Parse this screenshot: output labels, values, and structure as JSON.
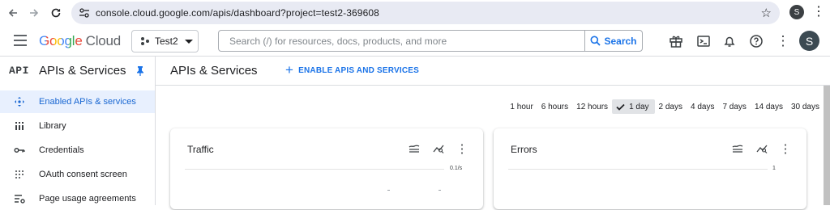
{
  "browser": {
    "url": "console.cloud.google.com/apis/dashboard?project=test2-369608",
    "profile_initial": "S"
  },
  "header": {
    "logo_google": "Google",
    "logo_cloud": "Cloud",
    "project": "Test2",
    "search_placeholder": "Search (/) for resources, docs, products, and more",
    "search_button": "Search",
    "avatar_initial": "S"
  },
  "sidebar": {
    "badge": "API",
    "title": "APIs & Services",
    "items": [
      {
        "label": "Enabled APIs & services",
        "icon": "diamond-arrows-icon",
        "active": true
      },
      {
        "label": "Library",
        "icon": "library-grid-icon"
      },
      {
        "label": "Credentials",
        "icon": "key-icon"
      },
      {
        "label": "OAuth consent screen",
        "icon": "dots-grid-icon"
      },
      {
        "label": "Page usage agreements",
        "icon": "settings-list-icon"
      }
    ]
  },
  "main": {
    "title": "APIs & Services",
    "enable_button": "ENABLE APIS AND SERVICES",
    "time_ranges": [
      "1 hour",
      "6 hours",
      "12 hours",
      "1 day",
      "2 days",
      "4 days",
      "7 days",
      "14 days",
      "30 days"
    ],
    "selected_range": "1 day",
    "cards": [
      {
        "title": "Traffic",
        "axis_label": "0.1/s"
      },
      {
        "title": "Errors",
        "axis_label": "1"
      }
    ]
  },
  "colors": {
    "accent": "#1a73e8",
    "active_bg": "#e8f0fe",
    "omnibox_bg": "#e8eaf3"
  }
}
